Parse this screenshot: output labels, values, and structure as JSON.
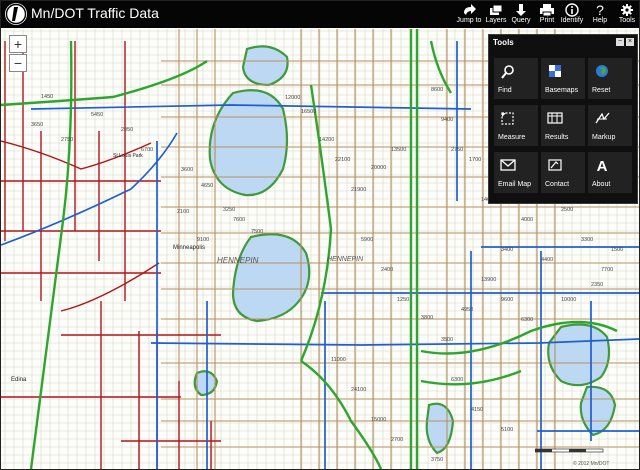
{
  "app": {
    "title": "Mn/DOT Traffic Data"
  },
  "toolbar": [
    {
      "id": "jump",
      "label": "Jump to",
      "icon": "arrow-jump-icon"
    },
    {
      "id": "layers",
      "label": "Layers",
      "icon": "layers-icon"
    },
    {
      "id": "query",
      "label": "Query",
      "icon": "query-arrow-icon"
    },
    {
      "id": "print",
      "label": "Print",
      "icon": "printer-icon"
    },
    {
      "id": "identify",
      "label": "Identify",
      "icon": "info-icon"
    },
    {
      "id": "help",
      "label": "Help",
      "icon": "question-icon"
    },
    {
      "id": "tools",
      "label": "Tools",
      "icon": "gear-icon"
    }
  ],
  "zoom": {
    "in_label": "+",
    "out_label": "−"
  },
  "tools_panel": {
    "title": "Tools",
    "minimize": "−",
    "close": "×",
    "items": [
      {
        "label": "Find",
        "icon": "magnifier-icon"
      },
      {
        "label": "Basemaps",
        "icon": "basemap-icon"
      },
      {
        "label": "Reset",
        "icon": "globe-icon"
      },
      {
        "label": "Measure",
        "icon": "measure-icon"
      },
      {
        "label": "Results",
        "icon": "table-icon"
      },
      {
        "label": "Markup",
        "icon": "markup-icon"
      },
      {
        "label": "Email Map",
        "icon": "envelope-icon"
      },
      {
        "label": "Contact",
        "icon": "contact-icon"
      },
      {
        "label": "About",
        "icon": "about-icon"
      }
    ]
  },
  "map": {
    "area_labels": [
      "HENNEPIN",
      "HENNEPIN",
      "Minneapolis",
      "Edina",
      "St Louis Park"
    ],
    "aadt_labels": [
      "1450",
      "3650",
      "2750",
      "5450",
      "2950",
      "6700",
      "3600",
      "4650",
      "3250",
      "7600",
      "7500",
      "2100",
      "9100",
      "12000",
      "16500",
      "14200",
      "22100",
      "21900",
      "20000",
      "13500",
      "8600",
      "9400",
      "2750",
      "1700",
      "1460",
      "3400",
      "4000",
      "4400",
      "2500",
      "3300",
      "7700",
      "5900",
      "2400",
      "1250",
      "3800",
      "3500",
      "4950",
      "13900",
      "9600",
      "6300",
      "10000",
      "2350",
      "1500",
      "11000",
      "24100",
      "15000",
      "2700",
      "3750",
      "6300",
      "4150",
      "5100"
    ],
    "colors": {
      "green": "#2ea52e",
      "blue": "#1f5fd1",
      "red": "#b0151b",
      "tan": "#b89060",
      "lake": "#bcd8f3",
      "lake_edge": "#3e9a3a"
    }
  },
  "scalebar": {
    "label": "1 mi"
  },
  "copyright": "© 2012 Mn/DOT"
}
